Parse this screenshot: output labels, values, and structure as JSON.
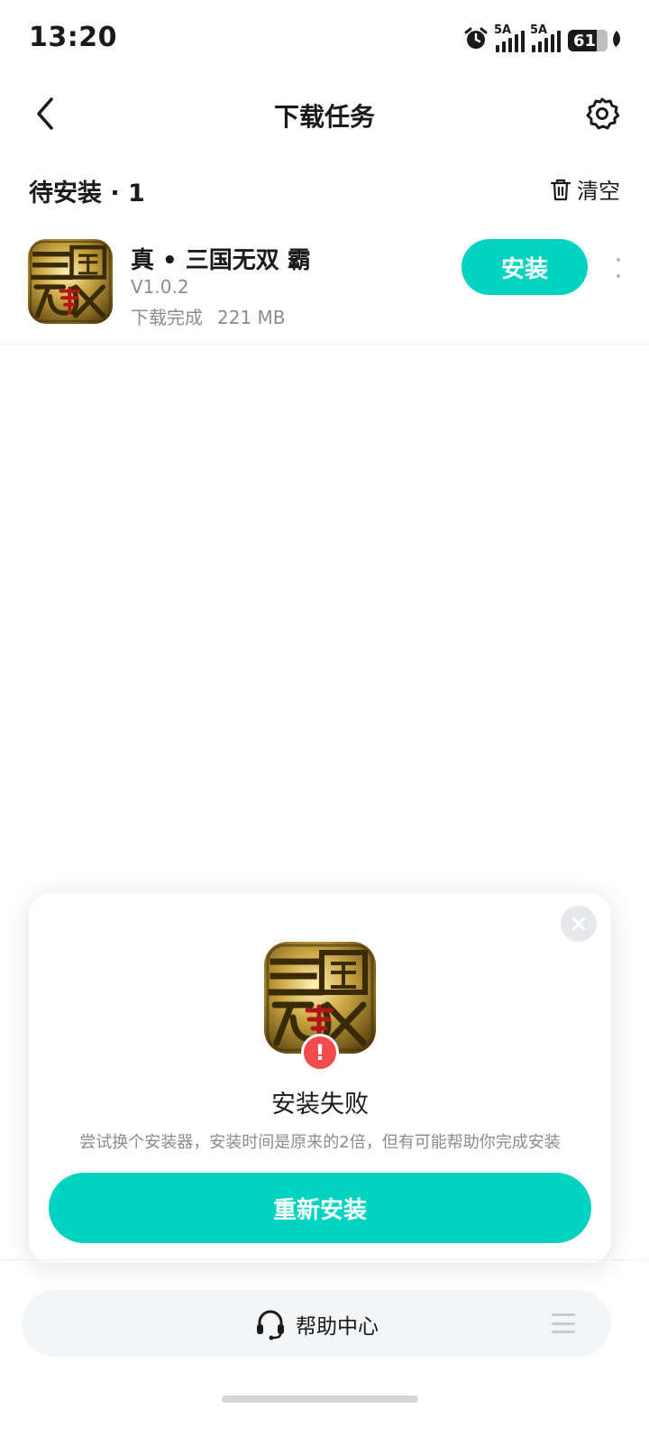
{
  "status_bar": {
    "time": "13:20",
    "signal1_label": "5A",
    "signal2_label": "5A",
    "battery_level": "61"
  },
  "header": {
    "title": "下载任务"
  },
  "section": {
    "title": "待安装 · 1",
    "clear_label": "清空"
  },
  "app": {
    "name": "真 • 三国无双 霸",
    "version": "V1.0.2",
    "status": "下载完成",
    "size": "221 MB",
    "install_label": "安装",
    "icon_text": "三国无双"
  },
  "dialog": {
    "title": "安装失败",
    "description": "尝试换个安装器，安装时间是原来的2倍，但有可能帮助你完成安装",
    "reinstall_label": "重新安装",
    "error_mark": "!"
  },
  "bottom": {
    "help_label": "帮助中心"
  },
  "colors": {
    "accent": "#00d3bf",
    "error": "#f24b4b",
    "muted_text": "#8c8c8c"
  }
}
